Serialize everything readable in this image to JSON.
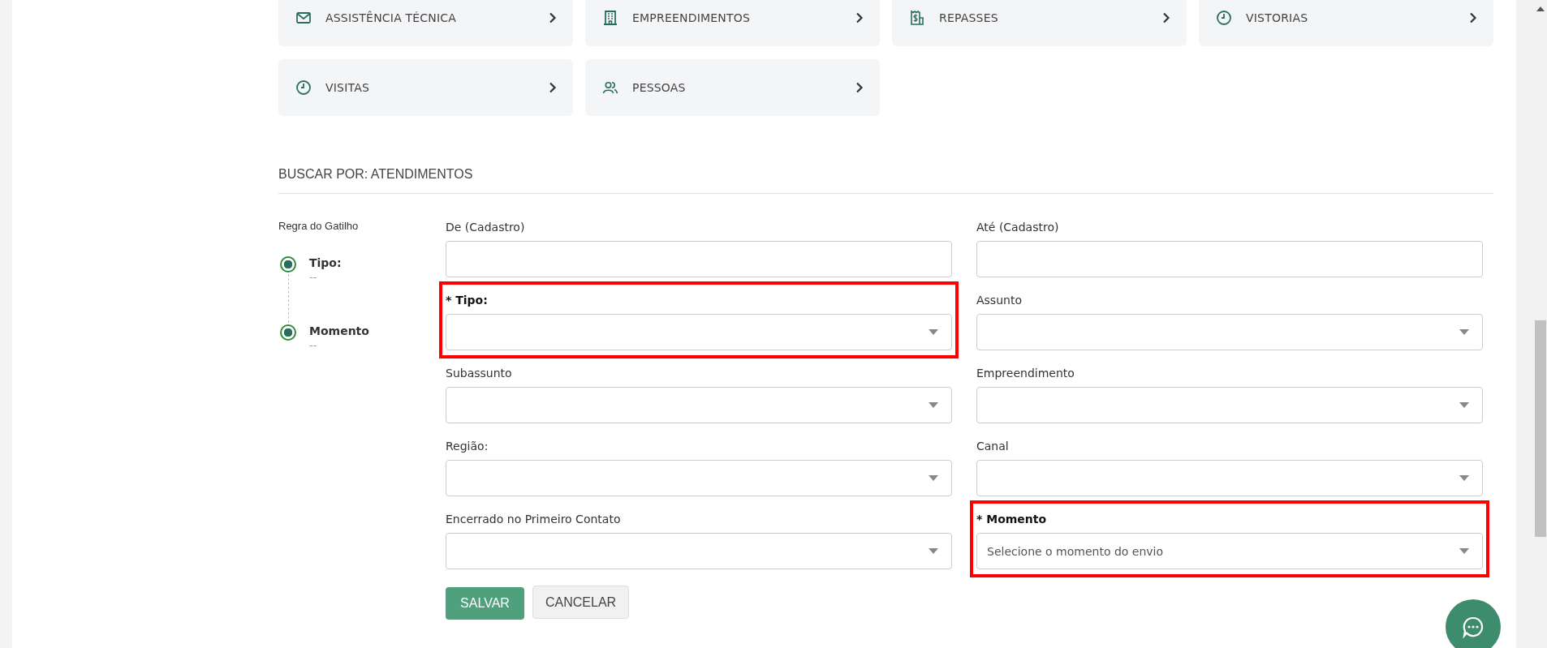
{
  "nav_cards": [
    {
      "label": "ASSISTÊNCIA TÉCNICA",
      "kind": "mail"
    },
    {
      "label": "EMPREENDIMENTOS",
      "kind": "building"
    },
    {
      "label": "REPASSES",
      "kind": "receipt"
    },
    {
      "label": "VISTORIAS",
      "kind": "clock"
    },
    {
      "label": "VISITAS",
      "kind": "clock"
    },
    {
      "label": "PESSOAS",
      "kind": "users"
    }
  ],
  "section_title": "BUSCAR POR: ATENDIMENTOS",
  "stepper": {
    "title": "Regra do Gatilho",
    "steps": [
      {
        "label": "Tipo:",
        "value": "--",
        "active": true
      },
      {
        "label": "Momento",
        "value": "--",
        "active": true
      }
    ]
  },
  "fields": [
    {
      "label": "De (Cadastro)",
      "kind": "text",
      "required": false,
      "highlighted": false
    },
    {
      "label": "Até (Cadastro)",
      "kind": "text",
      "required": false,
      "highlighted": false
    },
    {
      "label": "* Tipo:",
      "kind": "select",
      "required": true,
      "highlighted": true
    },
    {
      "label": "Assunto",
      "kind": "select",
      "required": false,
      "highlighted": false
    },
    {
      "label": "Subassunto",
      "kind": "select",
      "required": false,
      "highlighted": false
    },
    {
      "label": "Empreendimento",
      "kind": "select",
      "required": false,
      "highlighted": false
    },
    {
      "label": "Região:",
      "kind": "select",
      "required": false,
      "highlighted": false
    },
    {
      "label": "Canal",
      "kind": "select",
      "required": false,
      "highlighted": false
    },
    {
      "label": "Encerrado no Primeiro Contato",
      "kind": "select",
      "required": false,
      "highlighted": false
    },
    {
      "label": "* Momento",
      "kind": "select",
      "required": true,
      "highlighted": true,
      "placeholder": "Selecione o momento do envio"
    }
  ],
  "buttons": [
    {
      "label": "SALVAR",
      "kind": "primary"
    },
    {
      "label": "CANCELAR",
      "kind": "secondary"
    }
  ]
}
